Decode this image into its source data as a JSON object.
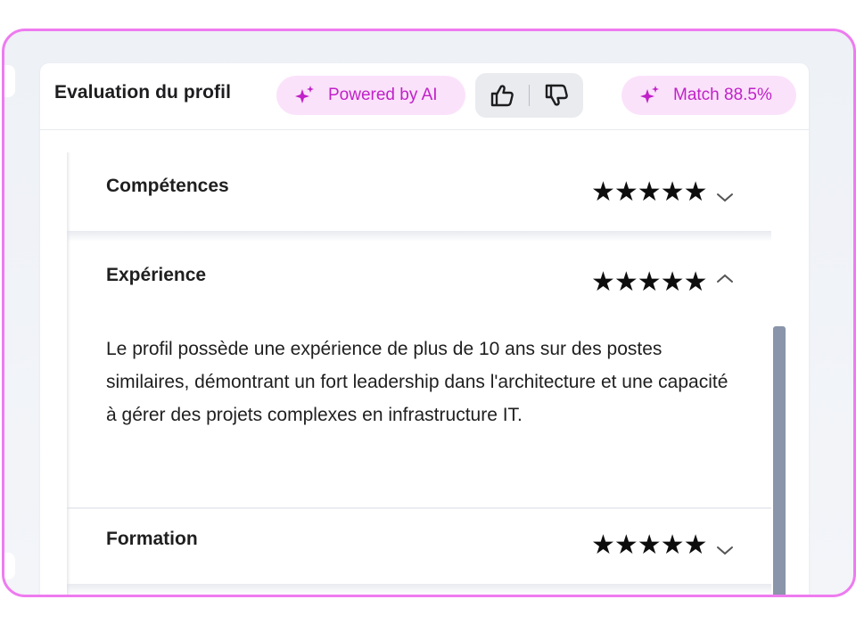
{
  "header": {
    "title": "Evaluation du profil",
    "powered_label": "Powered by AI",
    "match_label": "Match 88.5%"
  },
  "feedback": {
    "thumbs_up_icon": "thumbs-up-icon",
    "thumbs_down_icon": "thumbs-down-icon"
  },
  "sections": [
    {
      "title": "Compétences",
      "stars": "★★★★★",
      "rating": 5,
      "expanded": false
    },
    {
      "title": "Expérience",
      "stars": "★★★★★",
      "rating": 5,
      "expanded": true,
      "description": "Le profil possède une expérience de plus de 10 ans sur des postes similaires, démontrant un fort leadership dans l'architecture et une capacité à gérer des projets complexes en infrastructure IT."
    },
    {
      "title": "Formation",
      "stars": "★★★★★",
      "rating": 5,
      "expanded": false
    }
  ],
  "colors": {
    "accent": "#c021c8",
    "pill_bg": "#fbe2fb",
    "frame_border": "#ee7bf0",
    "scrollbar": "#8a94ab"
  }
}
